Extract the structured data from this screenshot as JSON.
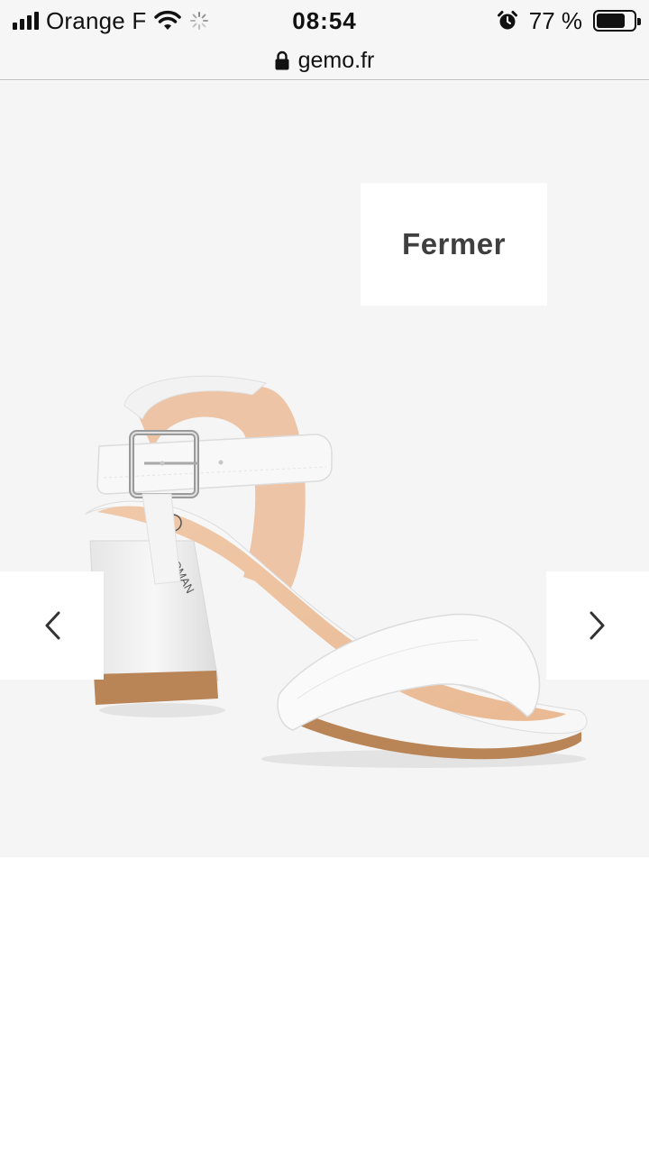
{
  "status_bar": {
    "carrier": "Orange F",
    "time": "08:54",
    "battery_percent": "77 %",
    "battery_level": 0.77,
    "icons": [
      "signal-icon",
      "wifi-icon",
      "loading-spinner-icon",
      "alarm-icon",
      "battery-icon"
    ]
  },
  "browser": {
    "url": "gemo.fr",
    "icons": [
      "lock-icon"
    ]
  },
  "viewer": {
    "close_label": "Fermer",
    "prev_icon": "chevron-left-icon",
    "next_icon": "chevron-right-icon",
    "image_subject": "white-sandal",
    "background_color": "#f5f5f6"
  }
}
